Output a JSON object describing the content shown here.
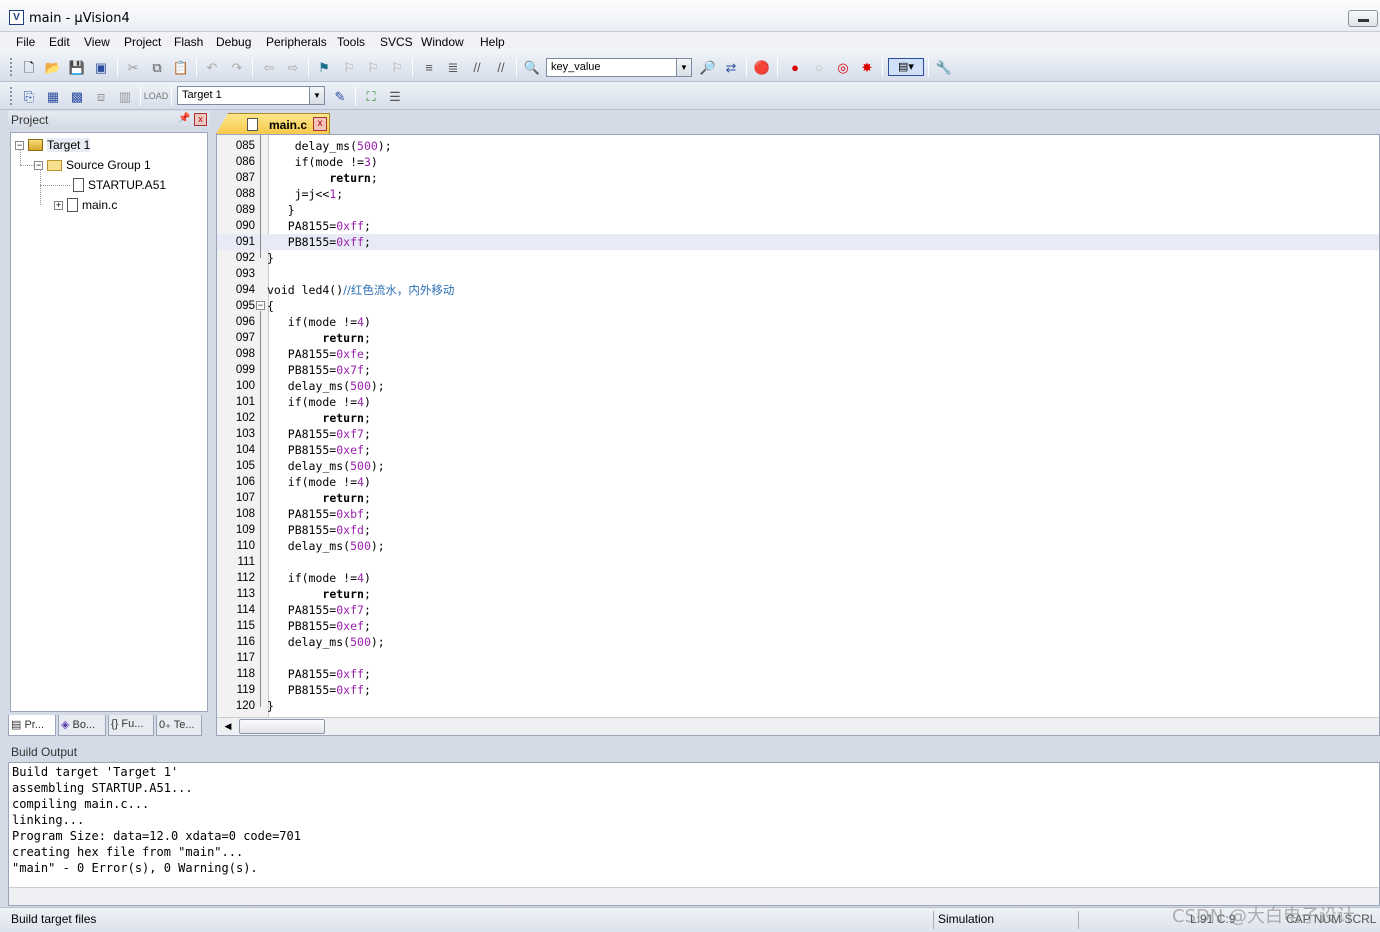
{
  "window": {
    "title": "main  - µVision4"
  },
  "menu": [
    "File",
    "Edit",
    "View",
    "Project",
    "Flash",
    "Debug",
    "Peripherals",
    "Tools",
    "SVCS",
    "Window",
    "Help"
  ],
  "toolbar": {
    "find_combo_value": "key_value",
    "target_combo_value": "Target 1"
  },
  "project_panel": {
    "title": "Project",
    "tree": {
      "target": "Target 1",
      "group": "Source Group 1",
      "files": [
        "STARTUP.A51",
        "main.c"
      ]
    },
    "tabs": [
      "Pr...",
      "Bo...",
      "Fu...",
      "Te..."
    ]
  },
  "editor": {
    "tab_label": "main.c",
    "lines": [
      {
        "n": "085",
        "code": "    delay_ms(500);"
      },
      {
        "n": "086",
        "code": "    if(mode !=3)"
      },
      {
        "n": "087",
        "code": "         return;"
      },
      {
        "n": "088",
        "code": "    j=j<<1;"
      },
      {
        "n": "089",
        "code": "   }"
      },
      {
        "n": "090",
        "code": "   PA8155=0xff;"
      },
      {
        "n": "091",
        "code": "   PB8155=0xff;"
      },
      {
        "n": "092",
        "code": "}"
      },
      {
        "n": "093",
        "code": ""
      },
      {
        "n": "094",
        "code": "void led4()//红色流水，内外移动"
      },
      {
        "n": "095",
        "code": "{"
      },
      {
        "n": "096",
        "code": "   if(mode !=4)"
      },
      {
        "n": "097",
        "code": "        return;"
      },
      {
        "n": "098",
        "code": "   PA8155=0xfe;"
      },
      {
        "n": "099",
        "code": "   PB8155=0x7f;"
      },
      {
        "n": "100",
        "code": "   delay_ms(500);"
      },
      {
        "n": "101",
        "code": "   if(mode !=4)"
      },
      {
        "n": "102",
        "code": "        return;"
      },
      {
        "n": "103",
        "code": "   PA8155=0xf7;"
      },
      {
        "n": "104",
        "code": "   PB8155=0xef;"
      },
      {
        "n": "105",
        "code": "   delay_ms(500);"
      },
      {
        "n": "106",
        "code": "   if(mode !=4)"
      },
      {
        "n": "107",
        "code": "        return;"
      },
      {
        "n": "108",
        "code": "   PA8155=0xbf;"
      },
      {
        "n": "109",
        "code": "   PB8155=0xfd;"
      },
      {
        "n": "110",
        "code": "   delay_ms(500);"
      },
      {
        "n": "111",
        "code": ""
      },
      {
        "n": "112",
        "code": "   if(mode !=4)"
      },
      {
        "n": "113",
        "code": "        return;"
      },
      {
        "n": "114",
        "code": "   PA8155=0xf7;"
      },
      {
        "n": "115",
        "code": "   PB8155=0xef;"
      },
      {
        "n": "116",
        "code": "   delay_ms(500);"
      },
      {
        "n": "117",
        "code": ""
      },
      {
        "n": "118",
        "code": "   PA8155=0xff;"
      },
      {
        "n": "119",
        "code": "   PB8155=0xff;"
      },
      {
        "n": "120",
        "code": "}"
      }
    ],
    "highlighted_line": "091"
  },
  "build_output": {
    "title": "Build Output",
    "lines": [
      "Build target 'Target 1'",
      "assembling STARTUP.A51...",
      "compiling main.c...",
      "linking...",
      "Program Size: data=12.0 xdata=0 code=701",
      "creating hex file from \"main\"...",
      "\"main\" - 0 Error(s), 0 Warning(s)."
    ]
  },
  "status": {
    "message": "Build target files",
    "mode": "Simulation",
    "position": "L:91 C:9",
    "caps": "CAP NUM SCRL"
  },
  "watermark": "CSDN @大白电子设计",
  "colors": {
    "number": "#9b1fae",
    "comment": "#2a6fb5",
    "highlight": "#e8eaf6",
    "tab_active": "#f7c94b"
  }
}
